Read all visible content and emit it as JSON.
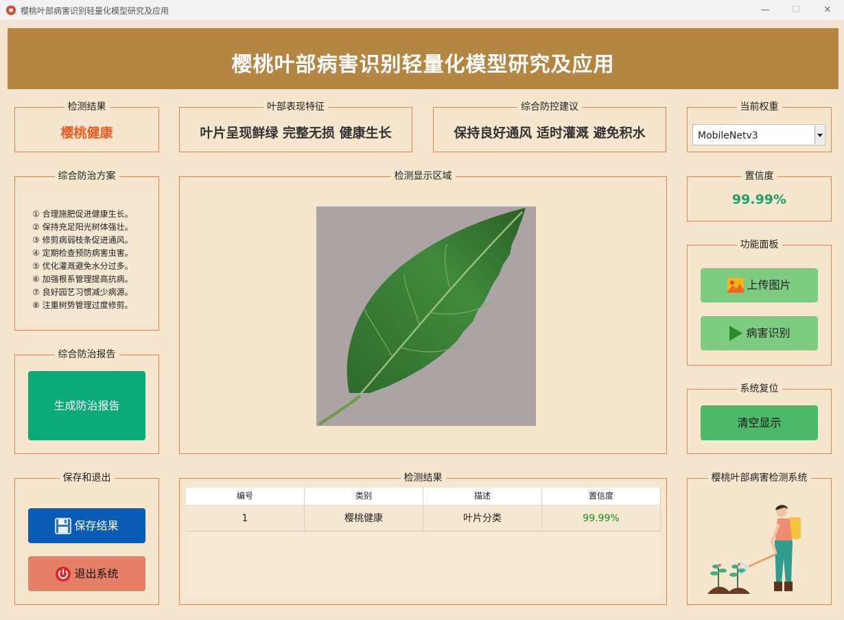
{
  "window": {
    "title": "樱桃叶部病害识别轻量化模型研究及应用",
    "minimize_glyph": "—",
    "maximize_glyph": "☐",
    "close_glyph": "✕"
  },
  "header": {
    "title": "樱桃叶部病害识别轻量化模型研究及应用"
  },
  "detect_result": {
    "title": "检测结果",
    "value": "樱桃健康",
    "color": "#f15a22"
  },
  "leaf_features": {
    "title": "叶部表现特征",
    "value": "叶片呈现鲜绿 完整无损 健康生长"
  },
  "advice": {
    "title": "综合防控建议",
    "value": "保持良好通风 适时灌溉 避免积水"
  },
  "weights": {
    "title": "当前权重",
    "selected": "MobileNetv3"
  },
  "plan": {
    "title": "综合防治方案",
    "items": [
      "① 合理施肥促进健康生长。",
      "② 保持充足阳光树体强壮。",
      "③ 修剪病弱枝条促进通风。",
      "④ 定期检查预防病害虫害。",
      "⑤ 优化灌溉避免水分过多。",
      "⑥ 加强根系管理提高抗病。",
      "⑦ 良好园艺习惯减少病源。",
      "⑧ 注重树势管理过度修剪。"
    ]
  },
  "display": {
    "title": "检测显示区域"
  },
  "confidence": {
    "title": "置信度",
    "value": "99.99%",
    "color": "#1aa36e"
  },
  "functions": {
    "title": "功能面板",
    "upload_label": "上传图片",
    "detect_label": "病害识别"
  },
  "report": {
    "title": "综合防治报告",
    "button_label": "生成防治报告"
  },
  "reset": {
    "title": "系统复位",
    "button_label": "清空显示"
  },
  "save_exit": {
    "title": "保存和退出",
    "save_label": "保存结果",
    "exit_label": "退出系统"
  },
  "results_table": {
    "title": "检测结果",
    "headers": [
      "编号",
      "类别",
      "描述",
      "置信度"
    ],
    "rows": [
      [
        "1",
        "樱桃健康",
        "叶片分类",
        "99.99%"
      ]
    ],
    "confidence_color": "#1a8a1a"
  },
  "system": {
    "title": "樱桃叶部病害检测系统"
  },
  "colors": {
    "header_bg": "#b48642",
    "report_button": "#0aab78",
    "function_button": "#7ecb82",
    "reset_button": "#4bb86a",
    "save_button": "#0b5cb5",
    "exit_button": "#e67f66"
  },
  "icons": {
    "upload": "image-icon",
    "detect": "play-icon",
    "save": "floppy-disk-icon",
    "exit": "power-icon",
    "system": "gardener-watering-plants-illustration",
    "app": "cherry-icon"
  }
}
